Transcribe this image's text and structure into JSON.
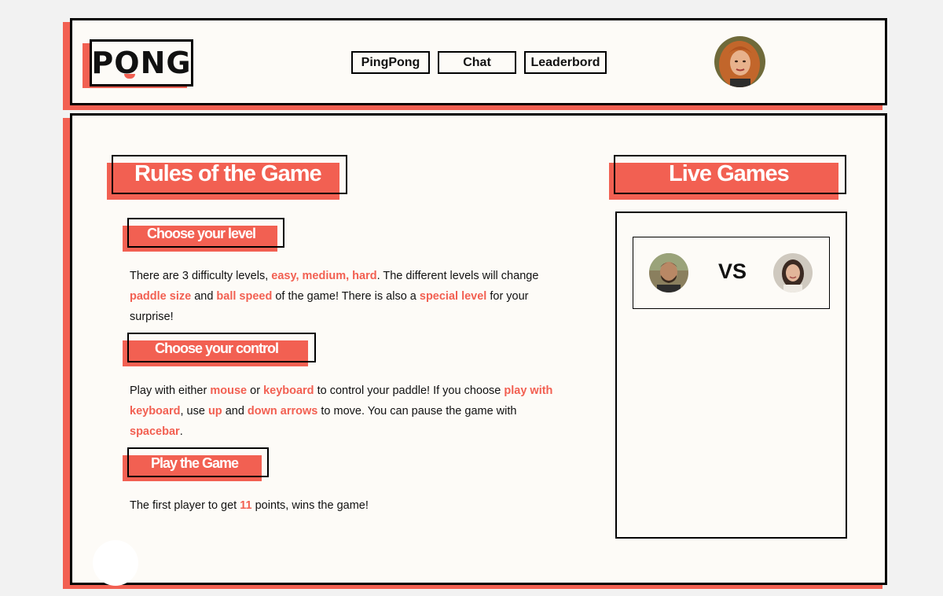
{
  "header": {
    "logo_text": "PONG",
    "nav": [
      {
        "label": "PingPong"
      },
      {
        "label": "Chat"
      },
      {
        "label": "Leaderbord"
      }
    ]
  },
  "rules": {
    "title": "Rules of the Game",
    "sections": [
      {
        "heading": "Choose your level",
        "text": [
          {
            "t": "There are 3 difficulty levels, ",
            "hl": false
          },
          {
            "t": "easy, medium, hard",
            "hl": true
          },
          {
            "t": ". The different levels will change ",
            "hl": false
          },
          {
            "t": "paddle size",
            "hl": true
          },
          {
            "t": " and ",
            "hl": false
          },
          {
            "t": "ball speed",
            "hl": true
          },
          {
            "t": " of the game! There is also a ",
            "hl": false
          },
          {
            "t": "special level",
            "hl": true
          },
          {
            "t": " for your surprise!",
            "hl": false
          }
        ]
      },
      {
        "heading": "Choose your control",
        "text": [
          {
            "t": "Play with either ",
            "hl": false
          },
          {
            "t": "mouse",
            "hl": true
          },
          {
            "t": " or ",
            "hl": false
          },
          {
            "t": "keyboard",
            "hl": true
          },
          {
            "t": " to control your paddle! If you choose ",
            "hl": false
          },
          {
            "t": "play with keyboard",
            "hl": true
          },
          {
            "t": ", use ",
            "hl": false
          },
          {
            "t": "up",
            "hl": true
          },
          {
            "t": " and ",
            "hl": false
          },
          {
            "t": "down arrows",
            "hl": true
          },
          {
            "t": " to move. You can pause the game with ",
            "hl": false
          },
          {
            "t": "spacebar",
            "hl": true
          },
          {
            "t": ".",
            "hl": false
          }
        ]
      },
      {
        "heading": "Play the Game",
        "text": [
          {
            "t": "The first player to get ",
            "hl": false
          },
          {
            "t": "11",
            "hl": true
          },
          {
            "t": " points, wins the game!",
            "hl": false
          }
        ]
      }
    ]
  },
  "live": {
    "title": "Live Games",
    "vs_label": "VS"
  },
  "colors": {
    "accent": "#f26052",
    "panel_bg": "#fdfbf7",
    "page_bg": "#f2f2f2"
  }
}
